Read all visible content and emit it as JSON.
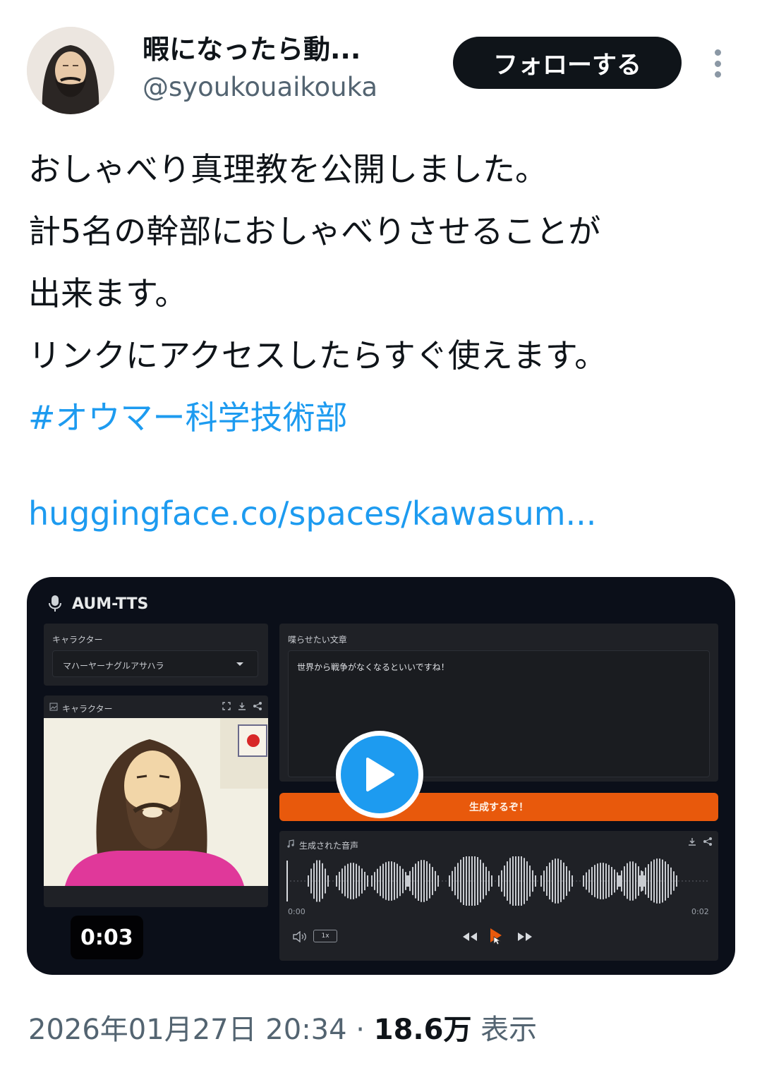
{
  "author": {
    "display_name": "暇になったら動...",
    "handle": "@syoukouaikouka",
    "follow_label": "フォローする"
  },
  "tweet": {
    "lines": [
      "おしゃべり真理教を公開しました。",
      "計5名の幹部におしゃべりさせることが",
      "出来ます。",
      "リンクにアクセスしたらすぐ使えます。"
    ],
    "hashtag": "#オウマー科学技術部",
    "link": "huggingface.co/spaces/kawasum..."
  },
  "media": {
    "app_title": "AUM-TTS",
    "character_label": "キャラクター",
    "character_value": "マハーヤーナグルアサハラ",
    "image_label": "キャラクター",
    "text_label": "喋らせたい文章",
    "text_value": "世界から戦争がなくなるといいですね！",
    "generate_label": "生成するぞ！",
    "audio_label": "生成された音声",
    "time_start": "0:00",
    "time_end": "0:02",
    "speed": "1x",
    "video_duration": "0:03"
  },
  "footer": {
    "datetime": "2026年01月27日 20:34",
    "separator": " · ",
    "views": "18.6万",
    "views_label": " 表示"
  },
  "colors": {
    "link": "#1d9bf0",
    "generate": "#e8590c",
    "follow_bg": "#0f1419"
  }
}
